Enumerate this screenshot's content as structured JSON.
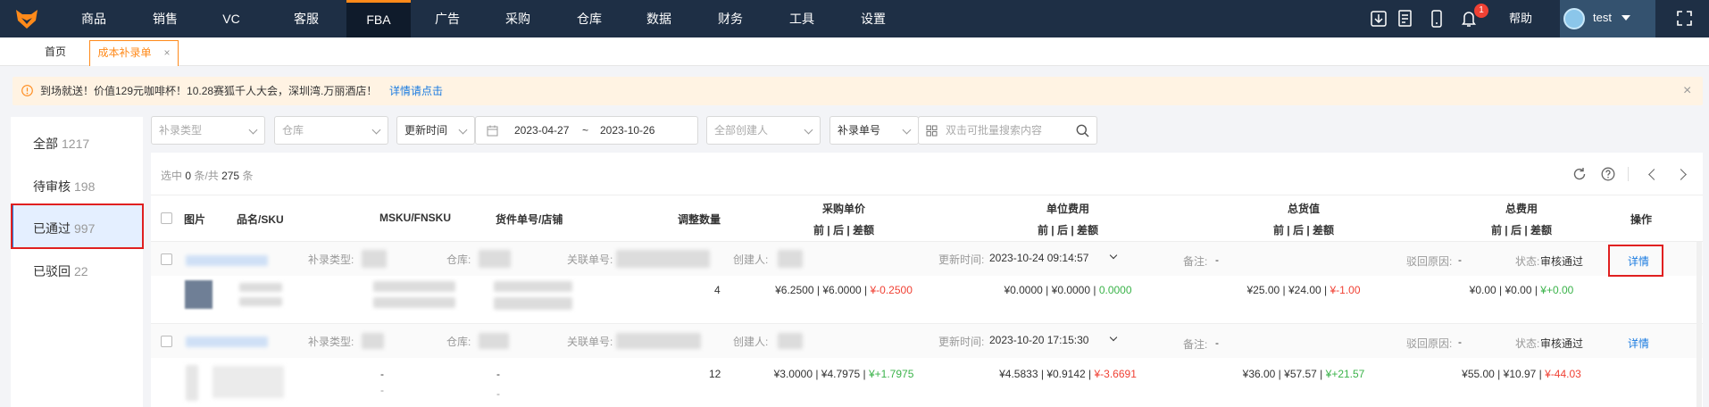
{
  "topnav": {
    "items": [
      {
        "label": "商品"
      },
      {
        "label": "销售"
      },
      {
        "label": "VC"
      },
      {
        "label": "客服"
      },
      {
        "label": "FBA",
        "active": true
      },
      {
        "label": "广告"
      },
      {
        "label": "采购"
      },
      {
        "label": "仓库"
      },
      {
        "label": "数据"
      },
      {
        "label": "财务"
      },
      {
        "label": "工具"
      },
      {
        "label": "设置"
      }
    ],
    "notification_count": "1",
    "help": "帮助",
    "user": "test",
    "colors": {
      "bar": "#1e2f45",
      "active": "#0f1b2b",
      "accent": "#ff8a1a"
    }
  },
  "tabs": {
    "home": "首页",
    "current": "成本补录单",
    "close": "×"
  },
  "notice": {
    "text": "到场就送！价值129元咖啡杯！10.28赛狐千人大会，深圳湾.万丽酒店！",
    "link": "详情请点击",
    "close": "×"
  },
  "left_panel": {
    "items": [
      {
        "label": "全部",
        "count": "1217"
      },
      {
        "label": "待审核",
        "count": "198"
      },
      {
        "label": "已通过",
        "count": "997",
        "selected": true
      },
      {
        "label": "已驳回",
        "count": "22"
      }
    ]
  },
  "filters": {
    "type_placeholder": "补录类型",
    "warehouse_placeholder": "仓库",
    "time_type": "更新时间",
    "date_start": "2023-04-27",
    "date_sep": "~",
    "date_end": "2023-10-26",
    "creator_placeholder": "全部创建人",
    "search_type": "补录单号",
    "search_placeholder": "双击可批量搜索内容"
  },
  "selection": {
    "prefix": "选中",
    "selected": "0",
    "middle": "条/共",
    "total": "275",
    "suffix": "条"
  },
  "table": {
    "headers": {
      "image": "图片",
      "name_sku": "品名/SKU",
      "msku": "MSKU/FNSKU",
      "goods_no": "货件单号/店铺",
      "qty": "调整数量",
      "purchase_price": "采购单价",
      "unit_fee": "单位费用",
      "total_value": "总货值",
      "total_fee": "总费用",
      "action": "操作",
      "sub": "前 | 后 | 差额"
    },
    "labels": {
      "type": "补录类型:",
      "warehouse": "仓库:",
      "related": "关联单号:",
      "creator": "创建人:",
      "update_time": "更新时间:",
      "remark": "备注:",
      "reject": "驳回原因:",
      "status": "状态:"
    },
    "rows": [
      {
        "update_time": "2023-10-24 09:14:57",
        "remark": "-",
        "reject": "-",
        "status": "审核通过",
        "detail": "详情",
        "qty": "4",
        "purchase": {
          "before": "¥6.2500",
          "after": "¥6.0000",
          "diff": "¥-0.2500"
        },
        "unit": {
          "before": "¥0.0000",
          "after": "¥0.0000",
          "diff": "0.0000"
        },
        "value": {
          "before": "¥25.00",
          "after": "¥24.00",
          "diff": "¥-1.00"
        },
        "fee": {
          "before": "¥0.00",
          "after": "¥0.00",
          "diff": "¥+0.00"
        }
      },
      {
        "update_time": "2023-10-20 17:15:30",
        "remark": "-",
        "reject": "-",
        "status": "审核通过",
        "detail": "详情",
        "msku": "-",
        "msku2": "-",
        "goods": "-",
        "goods2": "-",
        "qty": "12",
        "purchase": {
          "before": "¥3.0000",
          "after": "¥4.7975",
          "diff": "¥+1.7975"
        },
        "unit": {
          "before": "¥4.5833",
          "after": "¥0.9142",
          "diff": "¥-3.6691"
        },
        "value": {
          "before": "¥36.00",
          "after": "¥57.57",
          "diff": "¥+21.57"
        },
        "fee": {
          "before": "¥55.00",
          "after": "¥10.97",
          "diff": "¥-44.03"
        }
      }
    ]
  }
}
